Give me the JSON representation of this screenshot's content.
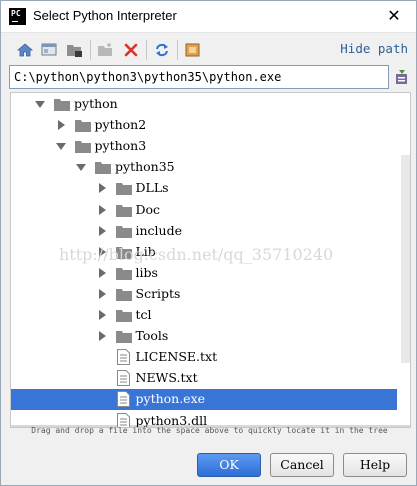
{
  "window": {
    "title": "Select Python Interpreter",
    "app_icon_text": "PC",
    "close_glyph": "✕"
  },
  "toolbar": {
    "buttons": [
      {
        "name": "home-icon"
      },
      {
        "name": "desktop-icon"
      },
      {
        "name": "project-folder-icon"
      },
      {
        "name": "new-folder-icon"
      },
      {
        "name": "delete-icon"
      },
      {
        "name": "refresh-icon"
      },
      {
        "name": "show-hidden-icon"
      }
    ],
    "hide_path_label": "Hide path"
  },
  "path": {
    "value": "C:\\python\\python3\\python35\\python.exe"
  },
  "tree": {
    "items": [
      {
        "label": "python",
        "depth": 1,
        "type": "folder",
        "expanded": true,
        "selected": false
      },
      {
        "label": "python2",
        "depth": 2,
        "type": "folder",
        "expanded": false,
        "selected": false
      },
      {
        "label": "python3",
        "depth": 2,
        "type": "folder",
        "expanded": true,
        "selected": false
      },
      {
        "label": "python35",
        "depth": 3,
        "type": "folder",
        "expanded": true,
        "selected": false
      },
      {
        "label": "DLLs",
        "depth": 4,
        "type": "folder",
        "expanded": false,
        "selected": false
      },
      {
        "label": "Doc",
        "depth": 4,
        "type": "folder",
        "expanded": false,
        "selected": false
      },
      {
        "label": "include",
        "depth": 4,
        "type": "folder",
        "expanded": false,
        "selected": false
      },
      {
        "label": "Lib",
        "depth": 4,
        "type": "folder",
        "expanded": false,
        "selected": false
      },
      {
        "label": "libs",
        "depth": 4,
        "type": "folder",
        "expanded": false,
        "selected": false
      },
      {
        "label": "Scripts",
        "depth": 4,
        "type": "folder",
        "expanded": false,
        "selected": false
      },
      {
        "label": "tcl",
        "depth": 4,
        "type": "folder",
        "expanded": false,
        "selected": false
      },
      {
        "label": "Tools",
        "depth": 4,
        "type": "folder",
        "expanded": false,
        "selected": false
      },
      {
        "label": "LICENSE.txt",
        "depth": 4,
        "type": "file",
        "selected": false
      },
      {
        "label": "NEWS.txt",
        "depth": 4,
        "type": "file",
        "selected": false
      },
      {
        "label": "python.exe",
        "depth": 4,
        "type": "file",
        "selected": true
      },
      {
        "label": "python3.dll",
        "depth": 4,
        "type": "file",
        "selected": false
      }
    ]
  },
  "watermark": "http://blog.csdn.net/qq_35710240",
  "hint": "Drag and drop a file into the space above to quickly locate it in the tree",
  "buttons": {
    "ok": "OK",
    "cancel": "Cancel",
    "help": "Help"
  },
  "colors": {
    "selection": "#3875d7",
    "link": "#2f5e9b",
    "primary_button": "#2d6ed8"
  }
}
